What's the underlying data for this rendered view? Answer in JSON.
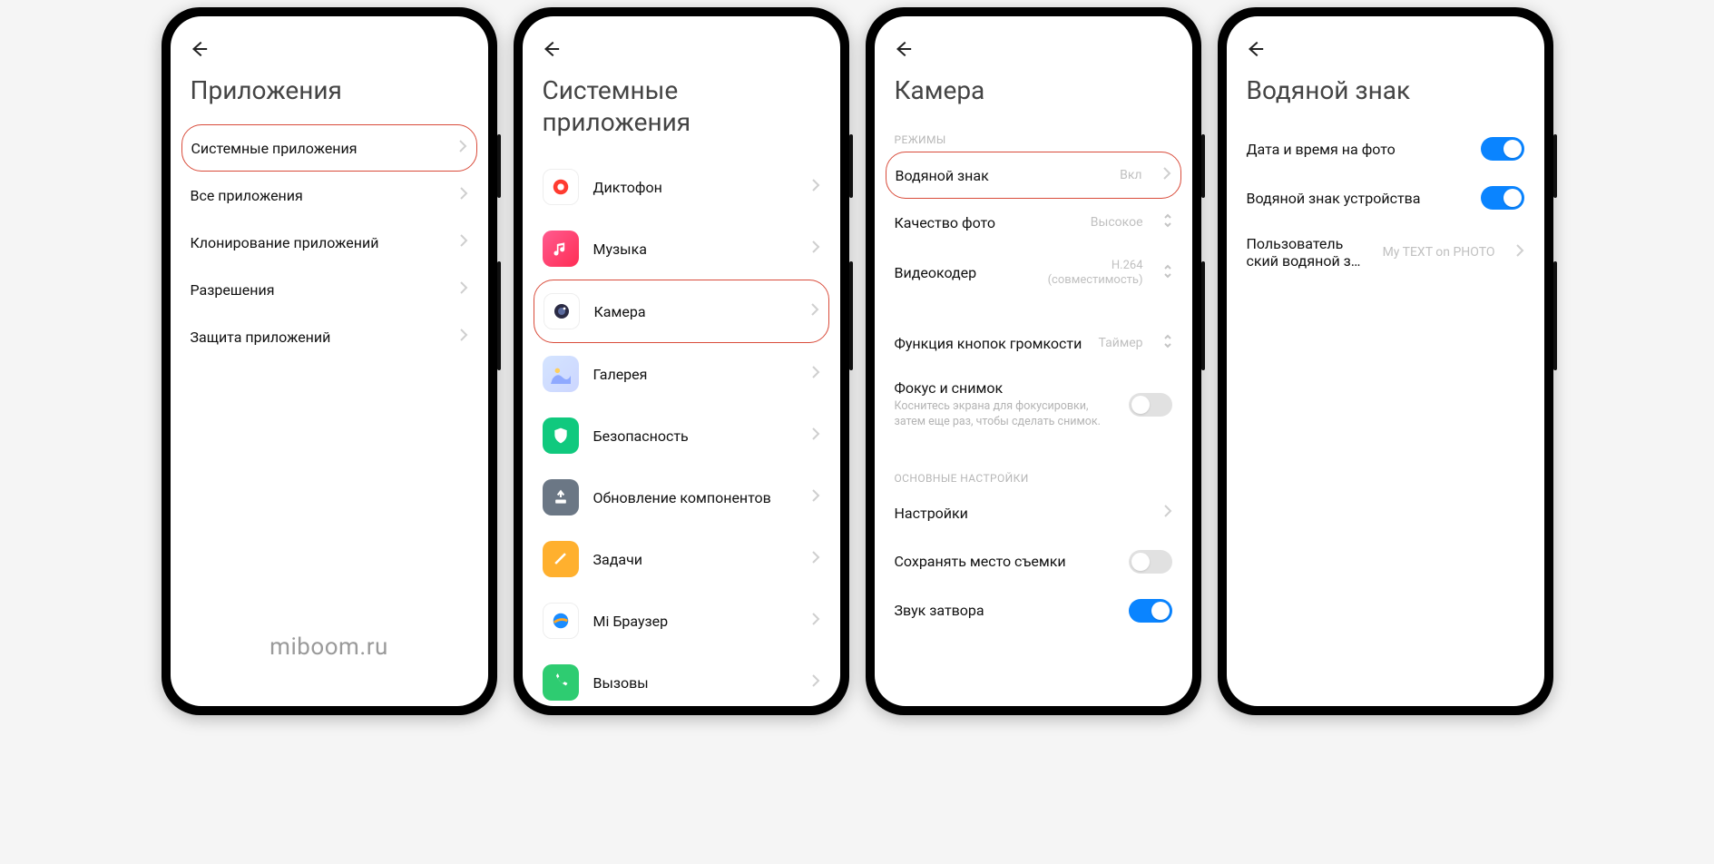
{
  "watermark": "miboom.ru",
  "phone1": {
    "title": "Приложения",
    "items": [
      {
        "label": "Системные приложения",
        "highlight": true
      },
      {
        "label": "Все приложения"
      },
      {
        "label": "Клонирование приложений"
      },
      {
        "label": "Разрешения"
      },
      {
        "label": "Защита приложений"
      }
    ]
  },
  "phone2": {
    "title": "Системные приложения",
    "items": [
      {
        "label": "Диктофон",
        "icon": "recorder"
      },
      {
        "label": "Музыка",
        "icon": "music"
      },
      {
        "label": "Камера",
        "icon": "camera",
        "highlight": true
      },
      {
        "label": "Галерея",
        "icon": "gallery"
      },
      {
        "label": "Безопасность",
        "icon": "security"
      },
      {
        "label": "Обновление компонентов",
        "icon": "update"
      },
      {
        "label": "Задачи",
        "icon": "tasks"
      },
      {
        "label": "Mi Браузер",
        "icon": "browser"
      },
      {
        "label": "Вызовы",
        "icon": "calls"
      }
    ]
  },
  "phone3": {
    "title": "Камера",
    "section_modes": "РЕЖИМЫ",
    "section_basic": "ОСНОВНЫЕ НАСТРОЙКИ",
    "watermark_row": {
      "label": "Водяной знак",
      "value": "Вкл"
    },
    "photo_quality": {
      "label": "Качество фото",
      "value": "Высокое"
    },
    "video_encoder": {
      "label": "Видеокодер",
      "value_line1": "H.264",
      "value_line2": "(совместимость)"
    },
    "volume_buttons": {
      "label": "Функция кнопок громкости",
      "value": "Таймер"
    },
    "focus_shoot": {
      "label": "Фокус и снимок",
      "sub": "Коснитесь экрана для фокусировки, затем еще раз, чтобы сделать снимок.",
      "toggle": false
    },
    "settings_row": {
      "label": "Настройки"
    },
    "save_location": {
      "label": "Сохранять место съемки",
      "toggle": false
    },
    "shutter_sound": {
      "label": "Звук затвора",
      "toggle": true
    }
  },
  "phone4": {
    "title": "Водяной знак",
    "date_time": {
      "label": "Дата и время на фото",
      "toggle": true
    },
    "device_wm": {
      "label": "Водяной знак устройства",
      "toggle": true
    },
    "custom_wm": {
      "label_line1": "Пользователь",
      "label_line2": "ский водяной з…",
      "value": "My TEXT on PHOTO"
    }
  }
}
